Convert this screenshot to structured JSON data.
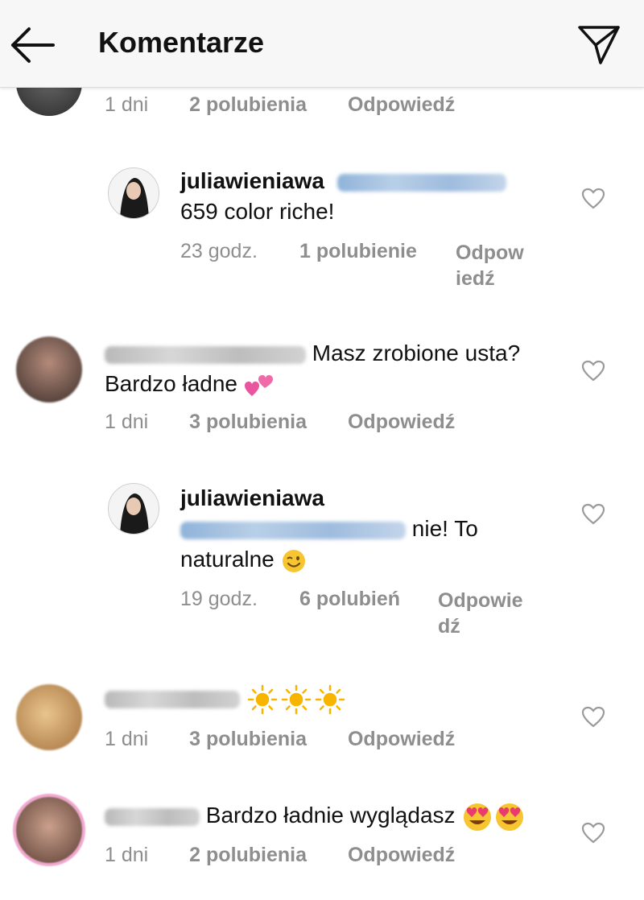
{
  "header": {
    "title": "Komentarze",
    "back_icon": "arrow-left-icon",
    "send_icon": "paper-plane-icon"
  },
  "comments": [
    {
      "time": "1 dni",
      "likes": "2 polubienia",
      "reply": "Odpowiedź"
    },
    {
      "username": "juliawieniawa",
      "text": "659 color riche!",
      "time": "23 godz.",
      "likes": "1 polubienie",
      "reply_line1": "Odpow",
      "reply_line2": "iedź"
    },
    {
      "text_line1": "Masz zrobione usta?",
      "text_line2": "Bardzo ładne",
      "emoji": "two-hearts-emoji",
      "time": "1 dni",
      "likes": "3 polubienia",
      "reply": "Odpowiedź"
    },
    {
      "username": "juliawieniawa",
      "text_line1": "nie! To",
      "text_line2": "naturalne",
      "emoji": "wink-emoji",
      "time": "19 godz.",
      "likes": "6 polubień",
      "reply_line1": "Odpowie",
      "reply_line2": "dź"
    },
    {
      "emoji": "sun-emoji",
      "time": "1 dni",
      "likes": "3 polubienia",
      "reply": "Odpowiedź"
    },
    {
      "text": "Bardzo ładnie wyglądasz",
      "emoji": "heart-eyes-emoji",
      "time": "1 dni",
      "likes": "2 polubienia",
      "reply": "Odpowiedź"
    }
  ],
  "colors": {
    "header_bg": "#f7f7f7",
    "meta_text": "#8e8e8e",
    "mention_blue": "#9ebcde",
    "heart_outline": "#9a9a9a"
  }
}
